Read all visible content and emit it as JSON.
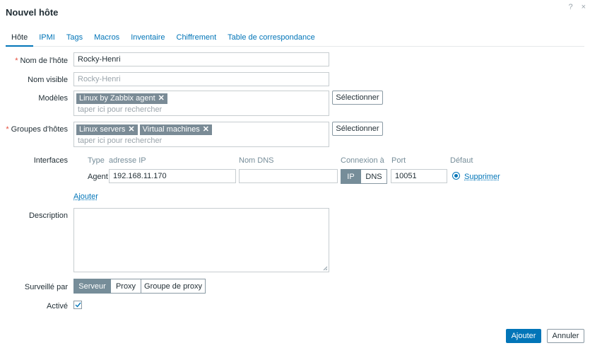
{
  "dialog": {
    "title": "Nouvel hôte",
    "help": "?",
    "close": "×"
  },
  "tabs": [
    {
      "label": "Hôte",
      "active": true
    },
    {
      "label": "IPMI"
    },
    {
      "label": "Tags"
    },
    {
      "label": "Macros"
    },
    {
      "label": "Inventaire"
    },
    {
      "label": "Chiffrement"
    },
    {
      "label": "Table de correspondance"
    }
  ],
  "form": {
    "host_name": {
      "label": "Nom de l'hôte",
      "required_mark": "*",
      "value": "Rocky-Henri"
    },
    "visible_name": {
      "label": "Nom visible",
      "placeholder": "Rocky-Henri"
    },
    "templates": {
      "label": "Modèles",
      "chips": [
        "Linux by Zabbix agent"
      ],
      "placeholder": "taper ici pour rechercher",
      "select_button": "Sélectionner"
    },
    "host_groups": {
      "label": "Groupes d'hôtes",
      "required_mark": "*",
      "chips": [
        "Linux servers",
        "Virtual machines"
      ],
      "placeholder": "taper ici pour rechercher",
      "select_button": "Sélectionner"
    },
    "interfaces": {
      "label": "Interfaces",
      "headers": {
        "type": "Type",
        "ip": "adresse IP",
        "dns": "Nom DNS",
        "connect": "Connexion à",
        "port": "Port",
        "default": "Défaut"
      },
      "row": {
        "type": "Agent",
        "ip": "192.168.11.170",
        "dns": "",
        "connect_options": [
          "IP",
          "DNS"
        ],
        "connect_selected": "IP",
        "port": "10051",
        "remove": "Supprimer"
      },
      "add": "Ajouter"
    },
    "description": {
      "label": "Description",
      "value": ""
    },
    "monitored_by": {
      "label": "Surveillé par",
      "options": [
        "Serveur",
        "Proxy",
        "Groupe de proxy"
      ],
      "selected": "Serveur"
    },
    "enabled": {
      "label": "Activé",
      "checked": true
    }
  },
  "footer": {
    "add": "Ajouter",
    "cancel": "Annuler"
  },
  "colors": {
    "accent": "#0275b8",
    "chip": "#7a8b96",
    "required": "#e54c3c"
  }
}
